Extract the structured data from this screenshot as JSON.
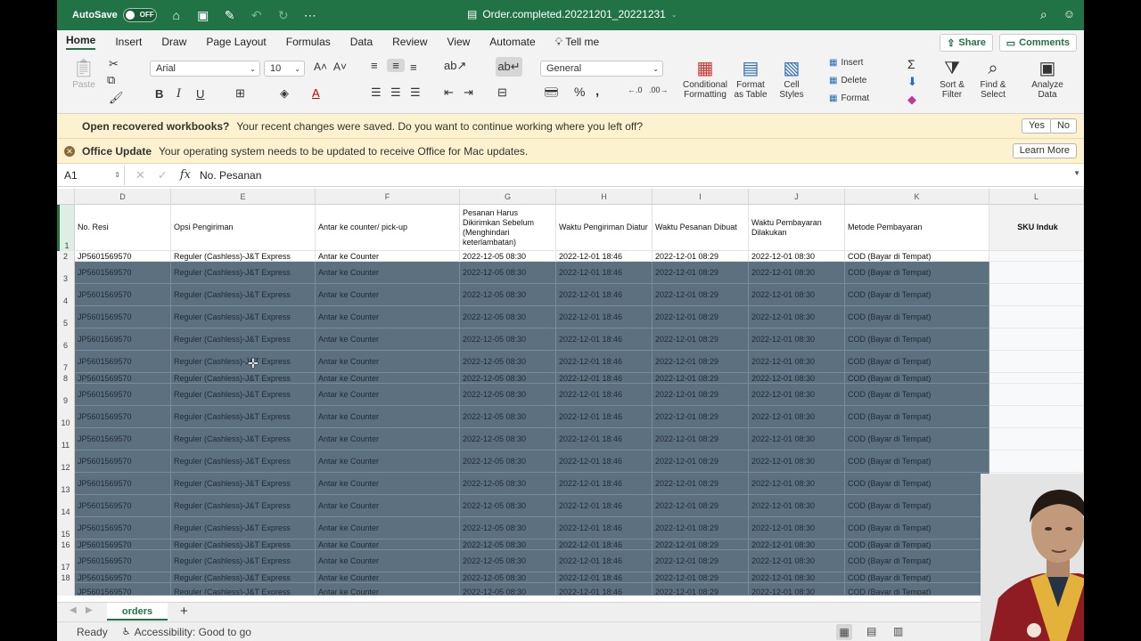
{
  "titlebar": {
    "autosave_label": "AutoSave",
    "autosave_state": "OFF",
    "doc_title": "Order.completed.20221201_20221231"
  },
  "tabs": [
    "Home",
    "Insert",
    "Draw",
    "Page Layout",
    "Formulas",
    "Data",
    "Review",
    "View",
    "Automate",
    "Tell me"
  ],
  "share_label": "Share",
  "comments_label": "Comments",
  "ribbon": {
    "paste_label": "Paste",
    "font_name": "Arial",
    "font_size": "10",
    "number_format": "General",
    "conditional_formatting": "Conditional Formatting",
    "format_as_table": "Format as Table",
    "cell_styles": "Cell Styles",
    "insert": "Insert",
    "delete": "Delete",
    "format": "Format",
    "sort_filter": "Sort & Filter",
    "find_select": "Find & Select",
    "analyze_data": "Analyze Data"
  },
  "recover_bar": {
    "title": "Open recovered workbooks?",
    "message": "Your recent changes were saved. Do you want to continue working where you left off?",
    "yes": "Yes",
    "no": "No"
  },
  "update_bar": {
    "title": "Office Update",
    "message": "Your operating system needs to be updated to receive Office for Mac updates.",
    "learn_more": "Learn More"
  },
  "formula_bar": {
    "cell_ref": "A1",
    "content": "No. Pesanan"
  },
  "columns": [
    "D",
    "E",
    "F",
    "G",
    "H",
    "I",
    "J",
    "K",
    "L"
  ],
  "header_row": [
    "No. Resi",
    "Opsi Pengiriman",
    "Antar ke counter/ pick-up",
    "Pesanan Harus Dikirimkan Sebelum (Menghindari keterlambatan)",
    "Waktu Pengiriman Diatur",
    "Waktu Pesanan Dibuat",
    "Waktu Pembayaran Dilakukan",
    "Metode Pembayaran",
    "SKU Induk"
  ],
  "row_values": [
    "JP5601569570",
    "Reguler (Cashless)-J&T Express",
    "Antar ke Counter",
    "2022-12-05 08:30",
    "2022-12-01 18:46",
    "2022-12-01 08:29",
    "2022-12-01 08:30",
    "COD (Bayar di Tempat)"
  ],
  "last_partial_row": [
    "JP5601569570",
    "Reguler (Cashless)-J&T Express",
    "Antar ke Counter",
    "2022-12-05 08:30",
    "2022-12-01 18:46",
    "2022-12-01 08:29",
    "2022-12-01 08:30",
    "COD (Bayar di Tempat)"
  ],
  "row_numbers": [
    "1",
    "2",
    "3",
    "4",
    "5",
    "6",
    "7",
    "8",
    "9",
    "10",
    "11",
    "12",
    "13",
    "14",
    "15",
    "16",
    "17",
    "18"
  ],
  "sheet_tab": "orders",
  "status": {
    "ready": "Ready",
    "accessibility": "Accessibility: Good to go"
  }
}
